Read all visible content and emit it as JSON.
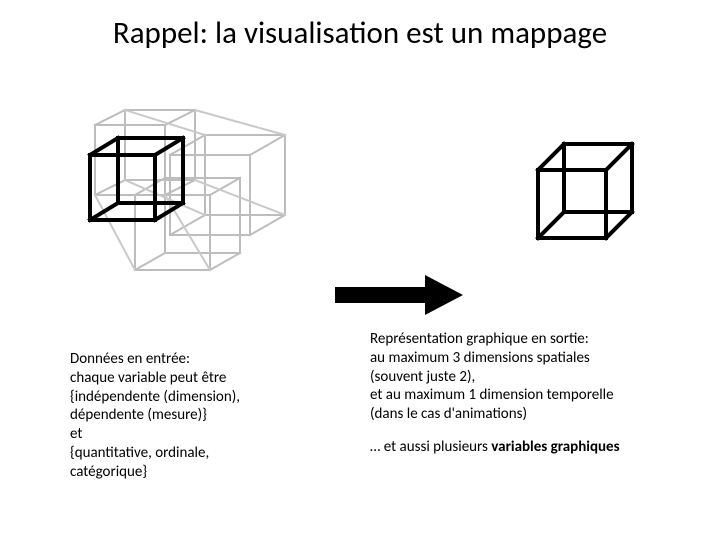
{
  "title": "Rappel: la visualisation est un mappage",
  "left": {
    "l1": "Données en entrée:",
    "l2": "chaque variable peut être",
    "l3": "{indépendente (dimension),",
    "l4": "dépendente (mesure)}",
    "l5": "et",
    "l6": "{quantitative, ordinale,",
    "l7": "catégorique}"
  },
  "right": {
    "l1": "Représentation graphique en sortie:",
    "l2": "au maximum 3 dimensions spatiales",
    "l3": "(souvent juste 2),",
    "l4": "et au maximum 1 dimension temporelle",
    "l5": "(dans le cas d'animations)",
    "l6a": "… et aussi plusieurs ",
    "l6b": "variables graphiques"
  }
}
